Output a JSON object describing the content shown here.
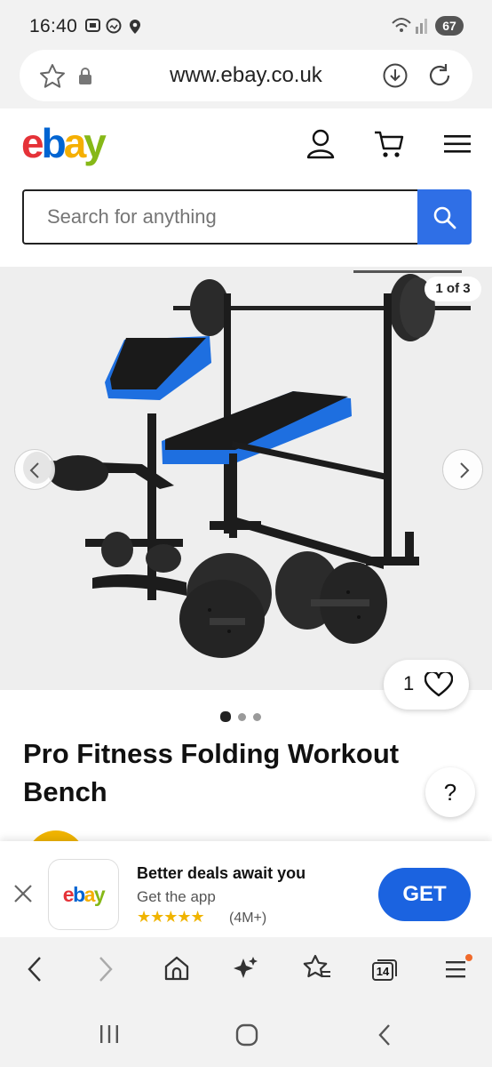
{
  "status_bar": {
    "time": "16:40",
    "battery": "67"
  },
  "browser": {
    "url": "www.ebay.co.uk",
    "tabs_count": "14"
  },
  "ebay": {
    "logo_letters": [
      "e",
      "b",
      "a",
      "y"
    ],
    "logo_colors": [
      "#e53238",
      "#0064d2",
      "#f5af02",
      "#86b817"
    ],
    "search_placeholder": "Search for anything"
  },
  "gallery": {
    "counter": "1 of 3",
    "watch_count": "1",
    "dots_total": 3,
    "dot_active_index": 0
  },
  "product": {
    "title": "Pro Fitness Folding Workout Bench"
  },
  "help": {
    "label": "?"
  },
  "app_banner": {
    "app_name": "ebay",
    "headline": "Better deals await you",
    "subtitle": "Get the app",
    "stars": "★★★★★",
    "ratings": "(4M+)",
    "cta": "GET"
  },
  "colors": {
    "accent": "#2f6fe6",
    "cta": "#1b63e0",
    "bench_blue": "#1e6fe0"
  }
}
